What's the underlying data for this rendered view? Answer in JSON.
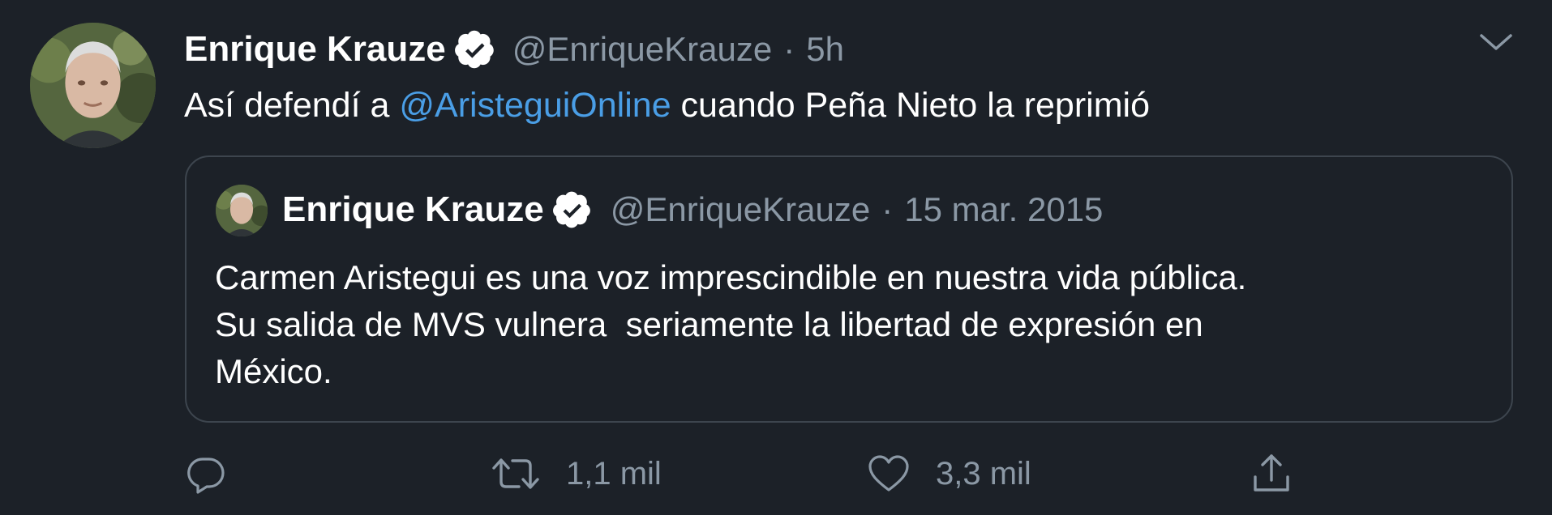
{
  "tweet": {
    "author_name": "Enrique Krauze",
    "handle": "@EnriqueKrauze",
    "separator": "·",
    "time": "5h",
    "text_before": "Así defendí a ",
    "mention": "@AristeguiOnline",
    "text_after": " cuando Peña Nieto la reprimió",
    "avatar_icon": "profile-photo",
    "verified_icon": "verified-badge-icon",
    "menu_icon": "chevron-down-icon"
  },
  "quote": {
    "author_name": "Enrique Krauze",
    "handle": "@EnriqueKrauze",
    "separator": "·",
    "date": "15 mar. 2015",
    "lines": [
      "Carmen Aristegui es una voz imprescindible en nuestra vida pública.",
      "Su salida de MVS vulnera  seriamente la libertad de expresión en",
      "México."
    ]
  },
  "actions": {
    "reply_icon": "reply-icon",
    "retweet_icon": "retweet-icon",
    "retweet_count": "1,1 mil",
    "like_icon": "heart-icon",
    "like_count": "3,3 mil",
    "share_icon": "share-icon"
  },
  "colors": {
    "background": "#1c2128",
    "text": "#ffffff",
    "secondary": "#8b98a5",
    "link": "#4a9ee6",
    "border": "#3d454e"
  }
}
